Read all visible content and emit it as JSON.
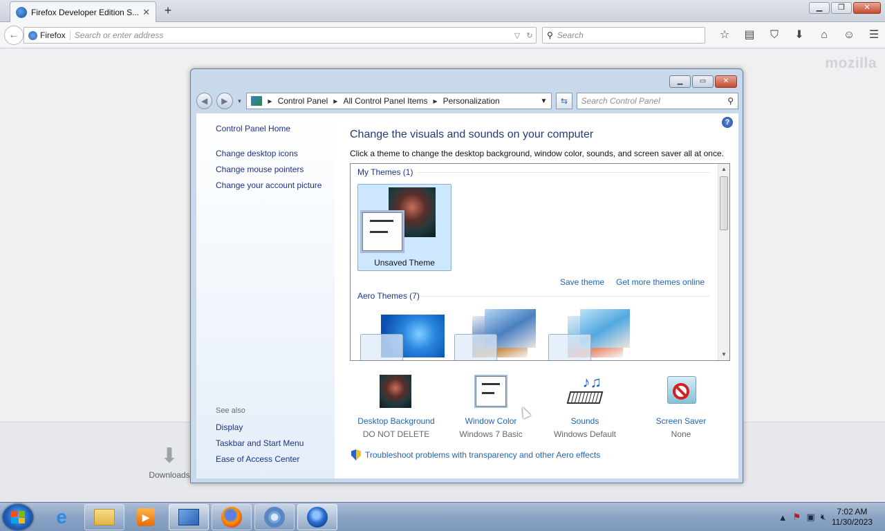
{
  "browser": {
    "tab_title": "Firefox Developer Edition S...",
    "tab_close": "✕",
    "new_tab": "+",
    "identity_label": "Firefox",
    "url_placeholder": "Search or enter address",
    "search_placeholder": "Search",
    "logo_text": "mozilla",
    "downloads_label": "Downloads",
    "toolbar_icons": [
      "star-icon",
      "reading-list-icon",
      "pocket-icon",
      "download-icon",
      "home-icon",
      "chat-icon",
      "menu-icon"
    ]
  },
  "control_panel": {
    "breadcrumb": [
      "Control Panel",
      "All Control Panel Items",
      "Personalization"
    ],
    "search_placeholder": "Search Control Panel",
    "sidebar": {
      "home": "Control Panel Home",
      "links": [
        "Change desktop icons",
        "Change mouse pointers",
        "Change your account picture"
      ],
      "see_also_heading": "See also",
      "see_also": [
        "Display",
        "Taskbar and Start Menu",
        "Ease of Access Center"
      ]
    },
    "main": {
      "title": "Change the visuals and sounds on your computer",
      "subtitle": "Click a theme to change the desktop background, window color, sounds, and screen saver all at once.",
      "my_themes_label": "My Themes (1)",
      "unsaved_theme": "Unsaved Theme",
      "save_theme": "Save theme",
      "get_more": "Get more themes online",
      "aero_themes_label": "Aero Themes (7)",
      "settings": [
        {
          "label": "Desktop Background",
          "value": "DO NOT DELETE"
        },
        {
          "label": "Window Color",
          "value": "Windows 7 Basic"
        },
        {
          "label": "Sounds",
          "value": "Windows Default"
        },
        {
          "label": "Screen Saver",
          "value": "None"
        }
      ],
      "troubleshoot": "Troubleshoot problems with transparency and other Aero effects"
    }
  },
  "taskbar": {
    "time": "7:02 AM",
    "date": "11/30/2023",
    "apps": [
      "internet-explorer",
      "file-explorer",
      "media-player",
      "control-panel",
      "firefox",
      "chromium",
      "firefox-developer-edition"
    ]
  },
  "colors": {
    "link_blue": "#1e64b4",
    "heading_blue": "#1f3b7a",
    "selection": "#cde8ff"
  }
}
